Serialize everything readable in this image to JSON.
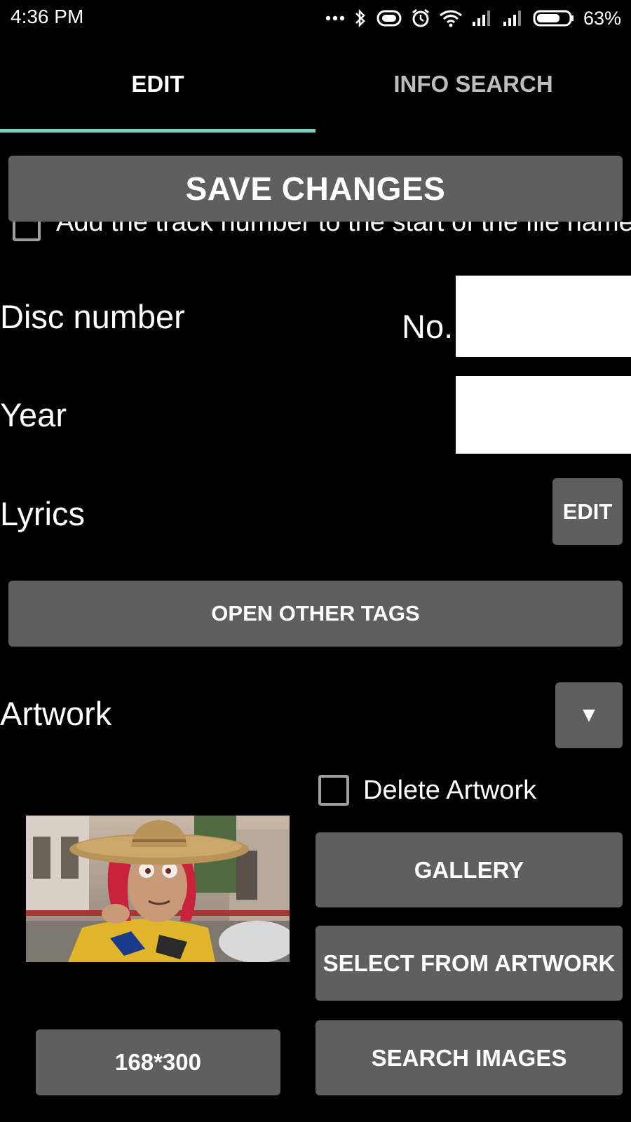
{
  "status_bar": {
    "time": "4:36  PM",
    "battery_percent": "63%",
    "icons": [
      "more-dots-icon",
      "bluetooth-icon",
      "vibrate-icon",
      "alarm-icon",
      "wifi-icon",
      "signal-icon",
      "signal-icon",
      "battery-icon"
    ]
  },
  "tabs": [
    {
      "label": "EDIT",
      "active": true
    },
    {
      "label": "INFO SEARCH",
      "active": false
    }
  ],
  "colors": {
    "tab_indicator": "#80cbc4",
    "button_bg": "#5f5f5f",
    "background": "#000000"
  },
  "save_button": "SAVE CHANGES",
  "track_number_option": {
    "label": "Add the track number to the start of the file name",
    "checked": false
  },
  "disc_number": {
    "label": "Disc number",
    "prefix": "No.",
    "value": ""
  },
  "year": {
    "label": "Year",
    "value": ""
  },
  "lyrics": {
    "label": "Lyrics",
    "edit_button": "EDIT"
  },
  "open_other_tags": "OPEN OTHER TAGS",
  "artwork": {
    "label": "Artwork",
    "dropdown_glyph": "▼",
    "delete_label": "Delete Artwork",
    "delete_checked": false,
    "size_label": "168*300",
    "gallery_button": "GALLERY",
    "select_button": "SELECT FROM ARTWORK",
    "search_button": "SEARCH IMAGES"
  }
}
